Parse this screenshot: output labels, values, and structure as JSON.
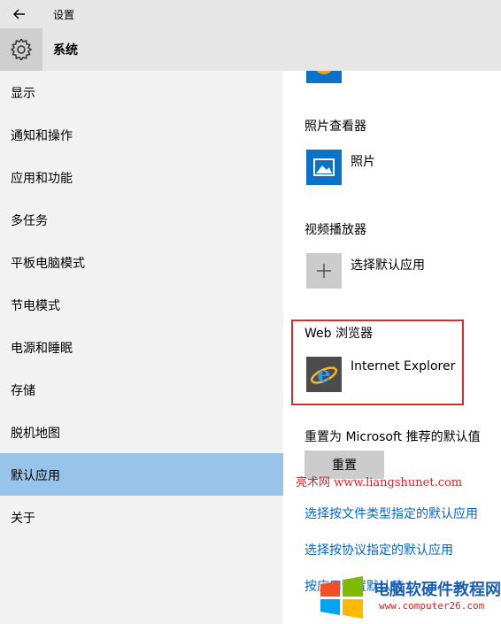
{
  "window": {
    "title": "设置"
  },
  "header": {
    "title": "系统",
    "icon": "gear-icon"
  },
  "sidebar": {
    "items": [
      {
        "label": "显示",
        "active": false
      },
      {
        "label": "通知和操作",
        "active": false
      },
      {
        "label": "应用和功能",
        "active": false
      },
      {
        "label": "多任务",
        "active": false
      },
      {
        "label": "平板电脑模式",
        "active": false
      },
      {
        "label": "节电模式",
        "active": false
      },
      {
        "label": "电源和睡眠",
        "active": false
      },
      {
        "label": "存储",
        "active": false
      },
      {
        "label": "脱机地图",
        "active": false
      },
      {
        "label": "默认应用",
        "active": true
      },
      {
        "label": "关于",
        "active": false
      }
    ]
  },
  "content": {
    "photo_viewer": {
      "title": "照片查看器",
      "app": "照片",
      "icon": "photos-icon"
    },
    "video_player": {
      "title": "视频播放器",
      "app": "选择默认应用",
      "icon": "plus-icon"
    },
    "web_browser": {
      "title": "Web 浏览器",
      "app": "Internet Explorer",
      "icon": "internet-explorer-icon"
    },
    "reset": {
      "text": "重置为 Microsoft 推荐的默认值",
      "button": "重置"
    },
    "links": [
      "选择按文件类型指定的默认应用",
      "选择按协议指定的默认应用",
      "按应用设置默认值"
    ]
  },
  "watermarks": {
    "site1": "亮术网 www.liangshunet.com",
    "logo_text": "电脑软硬件教程网",
    "logo_url": "www.computer26.com"
  },
  "colors": {
    "accent": "#0a72c7",
    "active_nav": "#99c4ea",
    "link": "#0066cc",
    "highlight": "#d0302f"
  }
}
